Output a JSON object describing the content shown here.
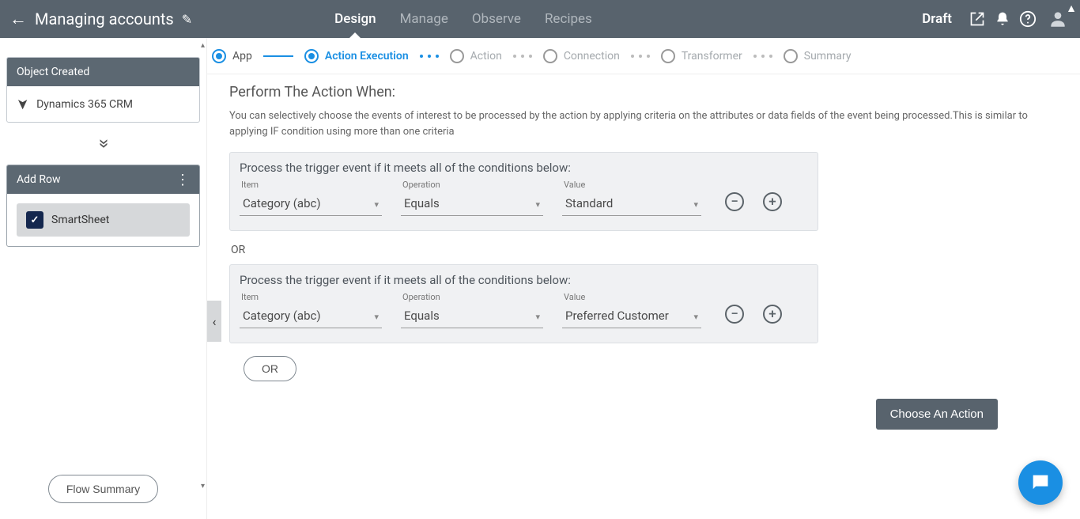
{
  "header": {
    "title": "Managing accounts",
    "status": "Draft",
    "nav": [
      "Design",
      "Manage",
      "Observe",
      "Recipes"
    ],
    "active_nav": "Design"
  },
  "sidebar": {
    "card1": {
      "title": "Object Created",
      "source": "Dynamics 365 CRM"
    },
    "card2": {
      "title": "Add Row",
      "source": "SmartSheet"
    },
    "flow_summary": "Flow Summary"
  },
  "stepper": {
    "steps": [
      "App",
      "Action Execution",
      "Action",
      "Connection",
      "Transformer",
      "Summary"
    ],
    "active": "Action Execution"
  },
  "main": {
    "section_title": "Perform The Action When:",
    "help": "You can selectively choose the events of interest to be processed by the action by applying criteria on the attributes or data fields of the event being processed.This is similar to applying IF condition using more than one criteria",
    "block_title": "Process the trigger event if it meets all of the conditions below:",
    "labels": {
      "item": "Item",
      "operation": "Operation",
      "value": "Value"
    },
    "conditions": [
      {
        "item": "Category (abc)",
        "operation": "Equals",
        "value": "Standard"
      },
      {
        "item": "Category (abc)",
        "operation": "Equals",
        "value": "Preferred Customer"
      }
    ],
    "or_text": "OR",
    "or_button": "OR",
    "choose_action": "Choose An Action"
  }
}
